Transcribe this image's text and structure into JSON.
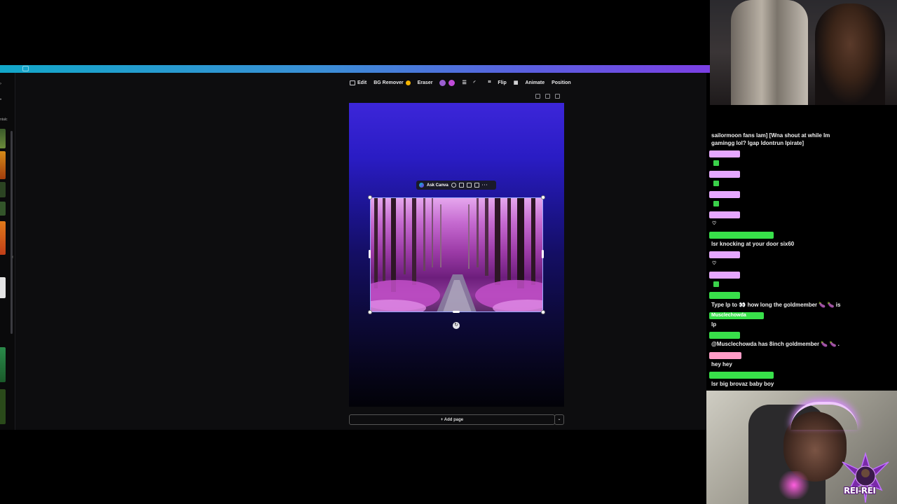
{
  "toolbar": {
    "edit": "Edit",
    "bg_remover": "BG Remover",
    "eraser": "Eraser",
    "flip": "Flip",
    "animate": "Animate",
    "position": "Position",
    "colors": [
      "#9a5fd0",
      "#c04bd8"
    ]
  },
  "left_rail": {
    "label": "ntalc"
  },
  "ask_bar": {
    "label": "Ask Canva"
  },
  "add_page": {
    "label": "+ Add page"
  },
  "chat": {
    "messages": [
      "sailormoon fans lam] [Wna shout at while Im",
      "gamingg lol? lgap ldontrun lpirate]",
      "lsr knocking at your door six60",
      "Type lp to 👀 how long the goldmember 🍆 🍆 is",
      "Musclechowda",
      "lp",
      "@Musclechowda has 8inch goldmember 🍆 🍆 .",
      "hey hey",
      "lsr big brovaz baby boy"
    ],
    "heart": "♡"
  },
  "overlay": {
    "badge": "REI-REI"
  }
}
